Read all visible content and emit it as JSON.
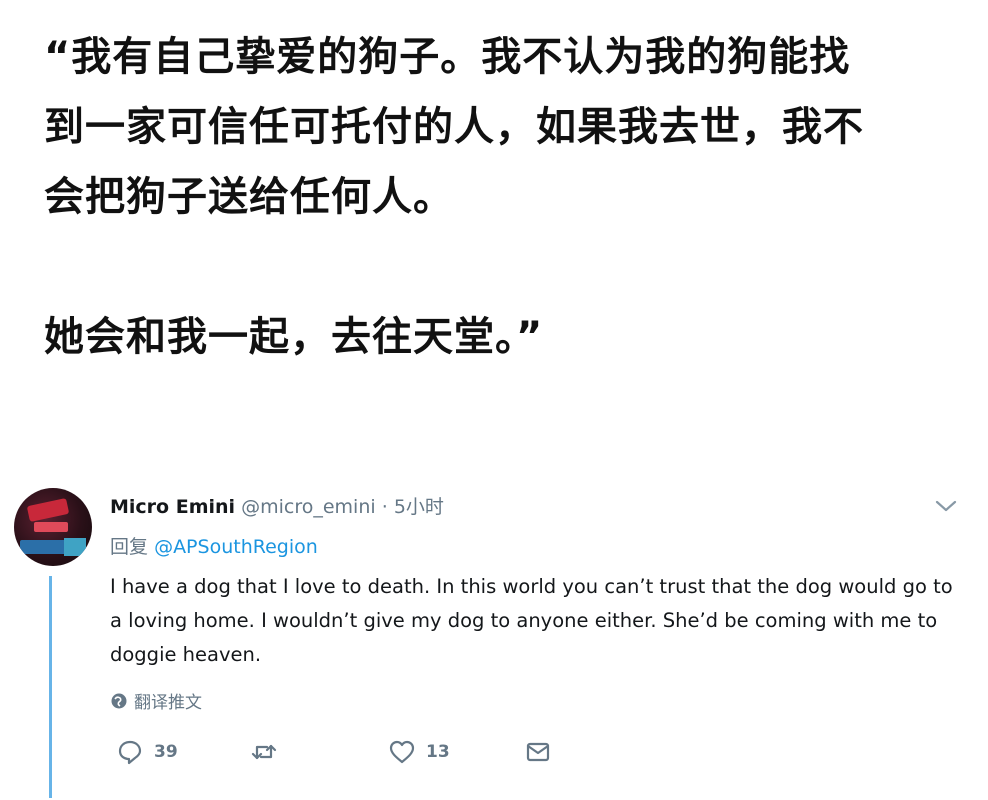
{
  "quote": {
    "lines": [
      "“我有自己挚爱的狗子。我不认为我的狗能找",
      "到一家可信任可托付的人，如果我去世，我不",
      "会把狗子送给任何人。",
      "她会和我一起，去往天堂。”"
    ]
  },
  "tweet": {
    "name": "Micro Emini",
    "handle": "@micro_emini",
    "separator": "·",
    "time": "5小时",
    "reply_prefix": "回复",
    "reply_mention": "@APSouthRegion",
    "text": "I have a dog that I love to death. In this world you can’t trust that the dog would go to a loving home. I wouldn’t give my dog to anyone either. She’d be coming with me to doggie heaven.",
    "translate_label": "翻译推文",
    "actions": {
      "reply_count": "39",
      "retweet_count": "",
      "like_count": "13"
    },
    "colors": {
      "thread_line": "#67b4e8",
      "mention": "#1b95e0",
      "muted": "#657786"
    },
    "icons": [
      "chevron-down-icon",
      "globe-icon",
      "reply-icon",
      "retweet-icon",
      "like-icon",
      "message-icon"
    ]
  }
}
